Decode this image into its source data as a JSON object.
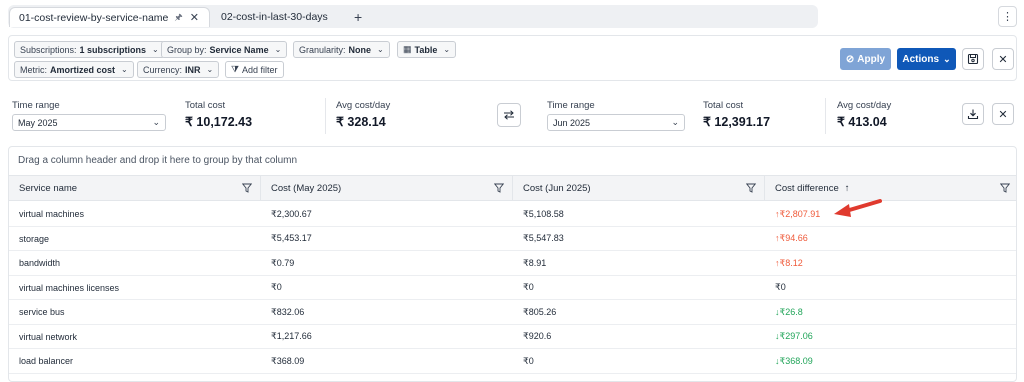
{
  "tabs": [
    {
      "label": "01-cost-review-by-service-name",
      "pin": "🖈",
      "close": "✕"
    },
    {
      "label": "02-cost-in-last-30-days"
    }
  ],
  "tab_add": "+",
  "kebab": "⋮",
  "filters": {
    "subscriptions_label": "Subscriptions:",
    "subscriptions_value": "1 subscriptions",
    "groupby_label": "Group by:",
    "groupby_value": "Service Name",
    "granularity_label": "Granularity:",
    "granularity_value": "None",
    "view_value": "Table",
    "metric_label": "Metric:",
    "metric_value": "Amortized cost",
    "currency_label": "Currency:",
    "currency_value": "INR",
    "add_filter": "Add filter"
  },
  "toolbar": {
    "apply": "Apply",
    "actions": "Actions"
  },
  "summary_left": {
    "time_range_label": "Time range",
    "time_range_value": "May 2025",
    "total_label": "Total cost",
    "total_value": "₹ 10,172.43",
    "avg_label": "Avg cost/day",
    "avg_value": "₹ 328.14"
  },
  "summary_right": {
    "time_range_label": "Time range",
    "time_range_value": "Jun 2025",
    "total_label": "Total cost",
    "total_value": "₹ 12,391.17",
    "avg_label": "Avg cost/day",
    "avg_value": "₹ 413.04"
  },
  "table": {
    "group_hint": "Drag a column header and drop it here to group by that column",
    "columns": [
      "Service name",
      "Cost (May 2025)",
      "Cost (Jun 2025)",
      "Cost difference"
    ],
    "sort_indicator": "↑",
    "rows": [
      {
        "name": "virtual machines",
        "may": "₹2,300.67",
        "jun": "₹5,108.58",
        "diff": "↑₹2,807.91",
        "trend": "up"
      },
      {
        "name": "storage",
        "may": "₹5,453.17",
        "jun": "₹5,547.83",
        "diff": "↑₹94.66",
        "trend": "up"
      },
      {
        "name": "bandwidth",
        "may": "₹0.79",
        "jun": "₹8.91",
        "diff": "↑₹8.12",
        "trend": "up"
      },
      {
        "name": "virtual machines licenses",
        "may": "₹0",
        "jun": "₹0",
        "diff": "₹0",
        "trend": "flat"
      },
      {
        "name": "service bus",
        "may": "₹832.06",
        "jun": "₹805.26",
        "diff": "↓₹26.8",
        "trend": "down"
      },
      {
        "name": "virtual network",
        "may": "₹1,217.66",
        "jun": "₹920.6",
        "diff": "↓₹297.06",
        "trend": "down"
      },
      {
        "name": "load balancer",
        "may": "₹368.09",
        "jun": "₹0",
        "diff": "↓₹368.09",
        "trend": "down"
      }
    ]
  },
  "colors": {
    "up": "#ef5b3b",
    "down": "#22a55a",
    "actions": "#0f58b8",
    "apply": "#7fa4d6",
    "annotation_arrow": "#e03a2e"
  }
}
